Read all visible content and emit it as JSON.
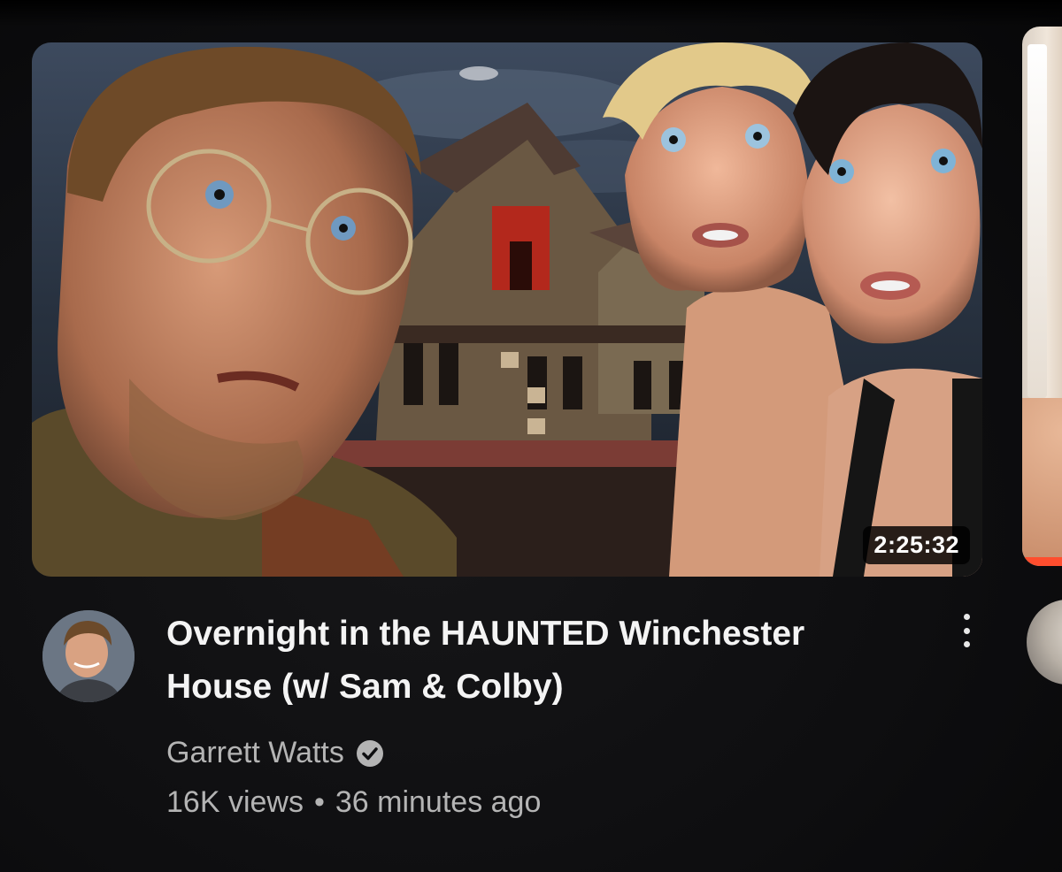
{
  "video": {
    "duration": "2:25:32",
    "title": "Overnight in the HAUNTED Winchester House (w/ Sam & Colby)",
    "channel": "Garrett Watts",
    "channel_verified": true,
    "views": "16K views",
    "separator": "•",
    "published": "36 minutes ago"
  },
  "icons": {
    "verified": "check-circle-icon",
    "more": "vertical-ellipsis-icon"
  },
  "colors": {
    "background": "#0e0e10",
    "title": "#f4f4f4",
    "meta_text": "#b4b4b4",
    "next_progress": "#ff4e2e"
  }
}
